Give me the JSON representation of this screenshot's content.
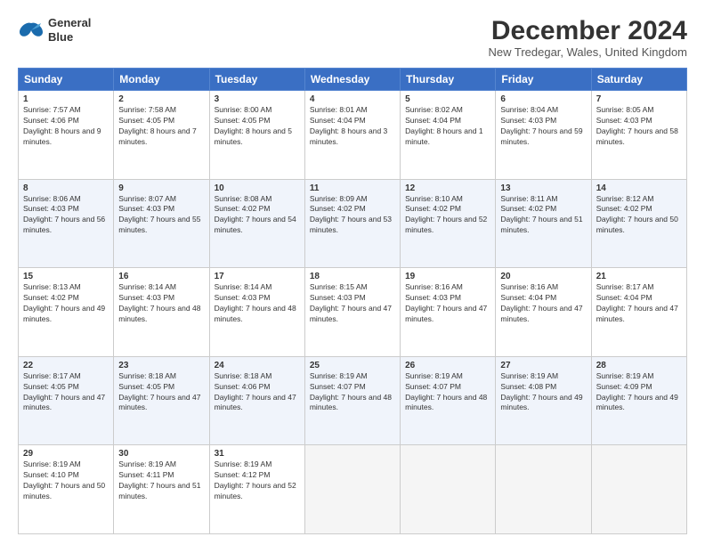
{
  "header": {
    "logo_line1": "General",
    "logo_line2": "Blue",
    "title": "December 2024",
    "location": "New Tredegar, Wales, United Kingdom"
  },
  "weekdays": [
    "Sunday",
    "Monday",
    "Tuesday",
    "Wednesday",
    "Thursday",
    "Friday",
    "Saturday"
  ],
  "weeks": [
    [
      {
        "day": "1",
        "info": "Sunrise: 7:57 AM\nSunset: 4:06 PM\nDaylight: 8 hours and 9 minutes."
      },
      {
        "day": "2",
        "info": "Sunrise: 7:58 AM\nSunset: 4:05 PM\nDaylight: 8 hours and 7 minutes."
      },
      {
        "day": "3",
        "info": "Sunrise: 8:00 AM\nSunset: 4:05 PM\nDaylight: 8 hours and 5 minutes."
      },
      {
        "day": "4",
        "info": "Sunrise: 8:01 AM\nSunset: 4:04 PM\nDaylight: 8 hours and 3 minutes."
      },
      {
        "day": "5",
        "info": "Sunrise: 8:02 AM\nSunset: 4:04 PM\nDaylight: 8 hours and 1 minute."
      },
      {
        "day": "6",
        "info": "Sunrise: 8:04 AM\nSunset: 4:03 PM\nDaylight: 7 hours and 59 minutes."
      },
      {
        "day": "7",
        "info": "Sunrise: 8:05 AM\nSunset: 4:03 PM\nDaylight: 7 hours and 58 minutes."
      }
    ],
    [
      {
        "day": "8",
        "info": "Sunrise: 8:06 AM\nSunset: 4:03 PM\nDaylight: 7 hours and 56 minutes."
      },
      {
        "day": "9",
        "info": "Sunrise: 8:07 AM\nSunset: 4:03 PM\nDaylight: 7 hours and 55 minutes."
      },
      {
        "day": "10",
        "info": "Sunrise: 8:08 AM\nSunset: 4:02 PM\nDaylight: 7 hours and 54 minutes."
      },
      {
        "day": "11",
        "info": "Sunrise: 8:09 AM\nSunset: 4:02 PM\nDaylight: 7 hours and 53 minutes."
      },
      {
        "day": "12",
        "info": "Sunrise: 8:10 AM\nSunset: 4:02 PM\nDaylight: 7 hours and 52 minutes."
      },
      {
        "day": "13",
        "info": "Sunrise: 8:11 AM\nSunset: 4:02 PM\nDaylight: 7 hours and 51 minutes."
      },
      {
        "day": "14",
        "info": "Sunrise: 8:12 AM\nSunset: 4:02 PM\nDaylight: 7 hours and 50 minutes."
      }
    ],
    [
      {
        "day": "15",
        "info": "Sunrise: 8:13 AM\nSunset: 4:02 PM\nDaylight: 7 hours and 49 minutes."
      },
      {
        "day": "16",
        "info": "Sunrise: 8:14 AM\nSunset: 4:03 PM\nDaylight: 7 hours and 48 minutes."
      },
      {
        "day": "17",
        "info": "Sunrise: 8:14 AM\nSunset: 4:03 PM\nDaylight: 7 hours and 48 minutes."
      },
      {
        "day": "18",
        "info": "Sunrise: 8:15 AM\nSunset: 4:03 PM\nDaylight: 7 hours and 47 minutes."
      },
      {
        "day": "19",
        "info": "Sunrise: 8:16 AM\nSunset: 4:03 PM\nDaylight: 7 hours and 47 minutes."
      },
      {
        "day": "20",
        "info": "Sunrise: 8:16 AM\nSunset: 4:04 PM\nDaylight: 7 hours and 47 minutes."
      },
      {
        "day": "21",
        "info": "Sunrise: 8:17 AM\nSunset: 4:04 PM\nDaylight: 7 hours and 47 minutes."
      }
    ],
    [
      {
        "day": "22",
        "info": "Sunrise: 8:17 AM\nSunset: 4:05 PM\nDaylight: 7 hours and 47 minutes."
      },
      {
        "day": "23",
        "info": "Sunrise: 8:18 AM\nSunset: 4:05 PM\nDaylight: 7 hours and 47 minutes."
      },
      {
        "day": "24",
        "info": "Sunrise: 8:18 AM\nSunset: 4:06 PM\nDaylight: 7 hours and 47 minutes."
      },
      {
        "day": "25",
        "info": "Sunrise: 8:19 AM\nSunset: 4:07 PM\nDaylight: 7 hours and 48 minutes."
      },
      {
        "day": "26",
        "info": "Sunrise: 8:19 AM\nSunset: 4:07 PM\nDaylight: 7 hours and 48 minutes."
      },
      {
        "day": "27",
        "info": "Sunrise: 8:19 AM\nSunset: 4:08 PM\nDaylight: 7 hours and 49 minutes."
      },
      {
        "day": "28",
        "info": "Sunrise: 8:19 AM\nSunset: 4:09 PM\nDaylight: 7 hours and 49 minutes."
      }
    ],
    [
      {
        "day": "29",
        "info": "Sunrise: 8:19 AM\nSunset: 4:10 PM\nDaylight: 7 hours and 50 minutes."
      },
      {
        "day": "30",
        "info": "Sunrise: 8:19 AM\nSunset: 4:11 PM\nDaylight: 7 hours and 51 minutes."
      },
      {
        "day": "31",
        "info": "Sunrise: 8:19 AM\nSunset: 4:12 PM\nDaylight: 7 hours and 52 minutes."
      },
      null,
      null,
      null,
      null
    ]
  ]
}
